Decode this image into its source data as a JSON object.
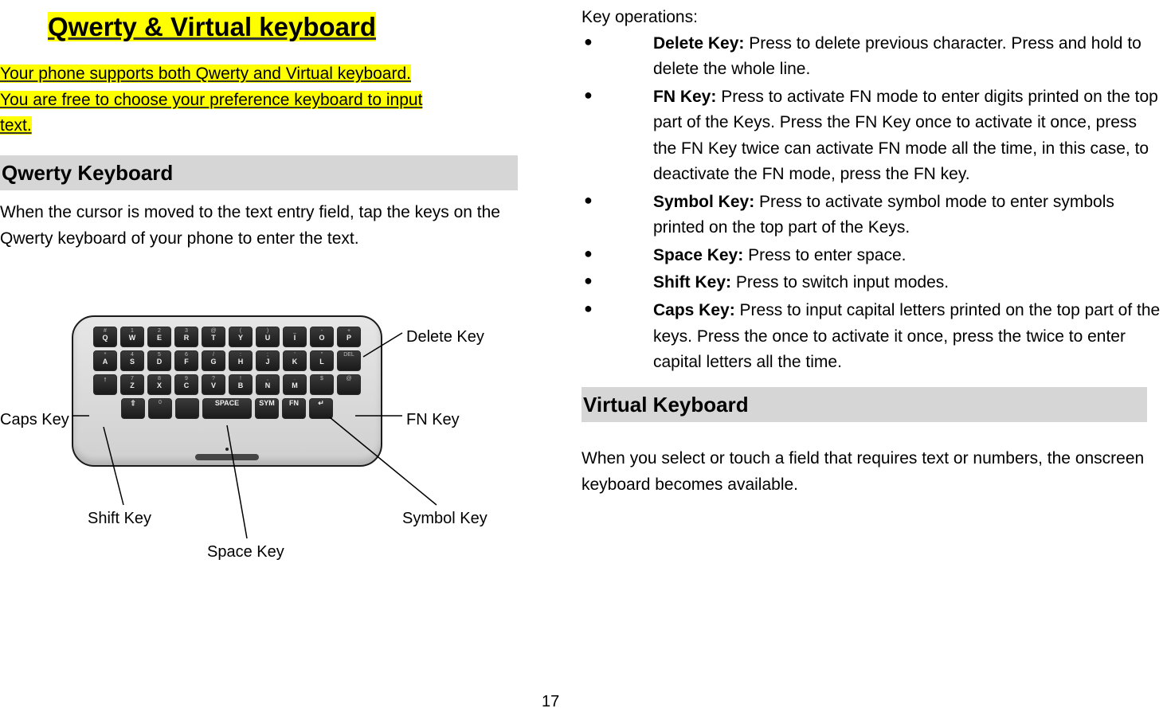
{
  "title": "Qwerty & Virtual keyboard",
  "intro_l1": "Your phone supports both Qwerty and Virtual keyboard. ",
  "intro_l2": "You are free to choose your preference keyboard to input ",
  "intro_l3": "text.",
  "section_qwerty": "Qwerty Keyboard",
  "qwerty_para": "When the cursor is moved to the text entry field, tap the keys on the Qwerty keyboard of your phone to enter the text.",
  "labels": {
    "delete": "Delete Key",
    "caps": "Caps Key",
    "fn": "FN Key",
    "shift": "Shift Key",
    "symbol": "Symbol Key",
    "space": "Space Key"
  },
  "right_intro": "Key operations:",
  "ops": {
    "delete": {
      "t": "Delete Key:",
      "d": " Press to delete previous character. Press and hold to delete the whole line."
    },
    "fn": {
      "t": "FN Key:",
      "d": " Press to activate FN mode to enter digits printed on the top part of the Keys. Press the FN Key once to activate it once, press the FN Key twice can activate FN mode all the time, in this case, to deactivate the FN mode, press the FN key."
    },
    "symbol": {
      "t": "Symbol Key:",
      "d": " Press to activate symbol mode to enter symbols printed on the top part of the Keys."
    },
    "space": {
      "t": "Space Key:",
      "d": " Press to enter space."
    },
    "shift": {
      "t": "Shift Key:",
      "d": " Press to switch input modes."
    },
    "caps": {
      "t": "Caps Key:",
      "d": " Press to input capital letters printed on the top part of the keys. Press the once to activate it once, press the twice to enter capital letters all the time."
    }
  },
  "section_virtual": "Virtual Keyboard",
  "virtual_para": "When you select or touch a field that requires text or numbers, the onscreen keyboard becomes available.",
  "page_number": "17",
  "keyboard_rows": [
    [
      [
        "#",
        "Q"
      ],
      [
        "1",
        "W"
      ],
      [
        "2",
        "E"
      ],
      [
        "3",
        "R"
      ],
      [
        "@",
        "T"
      ],
      [
        "(",
        "Y"
      ],
      [
        ")",
        "U"
      ],
      [
        "_",
        "I"
      ],
      [
        "-",
        "O"
      ],
      [
        "+",
        "P"
      ]
    ],
    [
      [
        "*",
        "A"
      ],
      [
        "4",
        "S"
      ],
      [
        "5",
        "D"
      ],
      [
        "6",
        "F"
      ],
      [
        "/",
        "G"
      ],
      [
        ":",
        "H"
      ],
      [
        ";",
        "J"
      ],
      [
        "'",
        "K"
      ],
      [
        "\"",
        "L"
      ],
      [
        "DEL",
        ""
      ]
    ],
    [
      [
        "",
        "↑"
      ],
      [
        "7",
        "Z"
      ],
      [
        "8",
        "X"
      ],
      [
        "9",
        "C"
      ],
      [
        "?",
        "V"
      ],
      [
        "!",
        "B"
      ],
      [
        ",",
        "N"
      ],
      [
        ".",
        "M"
      ],
      [
        "$",
        ""
      ],
      [
        "@",
        ""
      ]
    ],
    [
      [
        "",
        "⇧"
      ],
      [
        "0",
        ""
      ],
      [
        "",
        ""
      ],
      [
        "",
        "SPACE"
      ],
      [
        "",
        "SYM"
      ],
      [
        "",
        "FN"
      ],
      [
        "",
        "↵"
      ]
    ]
  ]
}
